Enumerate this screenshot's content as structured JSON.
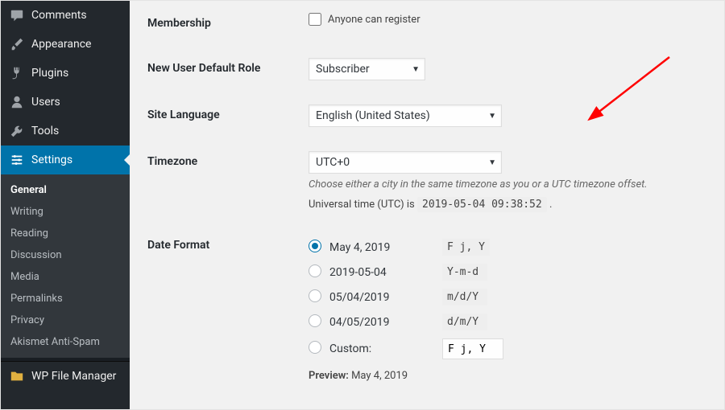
{
  "sidebar": {
    "items": [
      {
        "icon": "comment",
        "label": "Comments"
      },
      {
        "icon": "brush",
        "label": "Appearance"
      },
      {
        "icon": "plug",
        "label": "Plugins"
      },
      {
        "icon": "user",
        "label": "Users"
      },
      {
        "icon": "wrench",
        "label": "Tools"
      },
      {
        "icon": "sliders",
        "label": "Settings"
      }
    ],
    "submenu": [
      "General",
      "Writing",
      "Reading",
      "Discussion",
      "Media",
      "Permalinks",
      "Privacy",
      "Akismet Anti-Spam"
    ],
    "extra": {
      "icon": "folder",
      "label": "WP File Manager"
    }
  },
  "settings": {
    "membership": {
      "label": "Membership",
      "checkbox": "Anyone can register",
      "checked": false
    },
    "role": {
      "label": "New User Default Role",
      "value": "Subscriber"
    },
    "language": {
      "label": "Site Language",
      "value": "English (United States)"
    },
    "timezone": {
      "label": "Timezone",
      "value": "UTC+0",
      "help": "Choose either a city in the same timezone as you or a UTC timezone offset.",
      "utc_prefix": "Universal time (UTC) is",
      "utc_value": "2019-05-04 09:38:52"
    },
    "date_format": {
      "label": "Date Format",
      "options": [
        {
          "example": "May 4, 2019",
          "code": "F j, Y",
          "selected": true
        },
        {
          "example": "2019-05-04",
          "code": "Y-m-d",
          "selected": false
        },
        {
          "example": "05/04/2019",
          "code": "m/d/Y",
          "selected": false
        },
        {
          "example": "04/05/2019",
          "code": "d/m/Y",
          "selected": false
        }
      ],
      "custom": {
        "label": "Custom:",
        "value": "F j, Y",
        "selected": false
      },
      "preview_label": "Preview:",
      "preview_value": "May 4, 2019"
    }
  }
}
